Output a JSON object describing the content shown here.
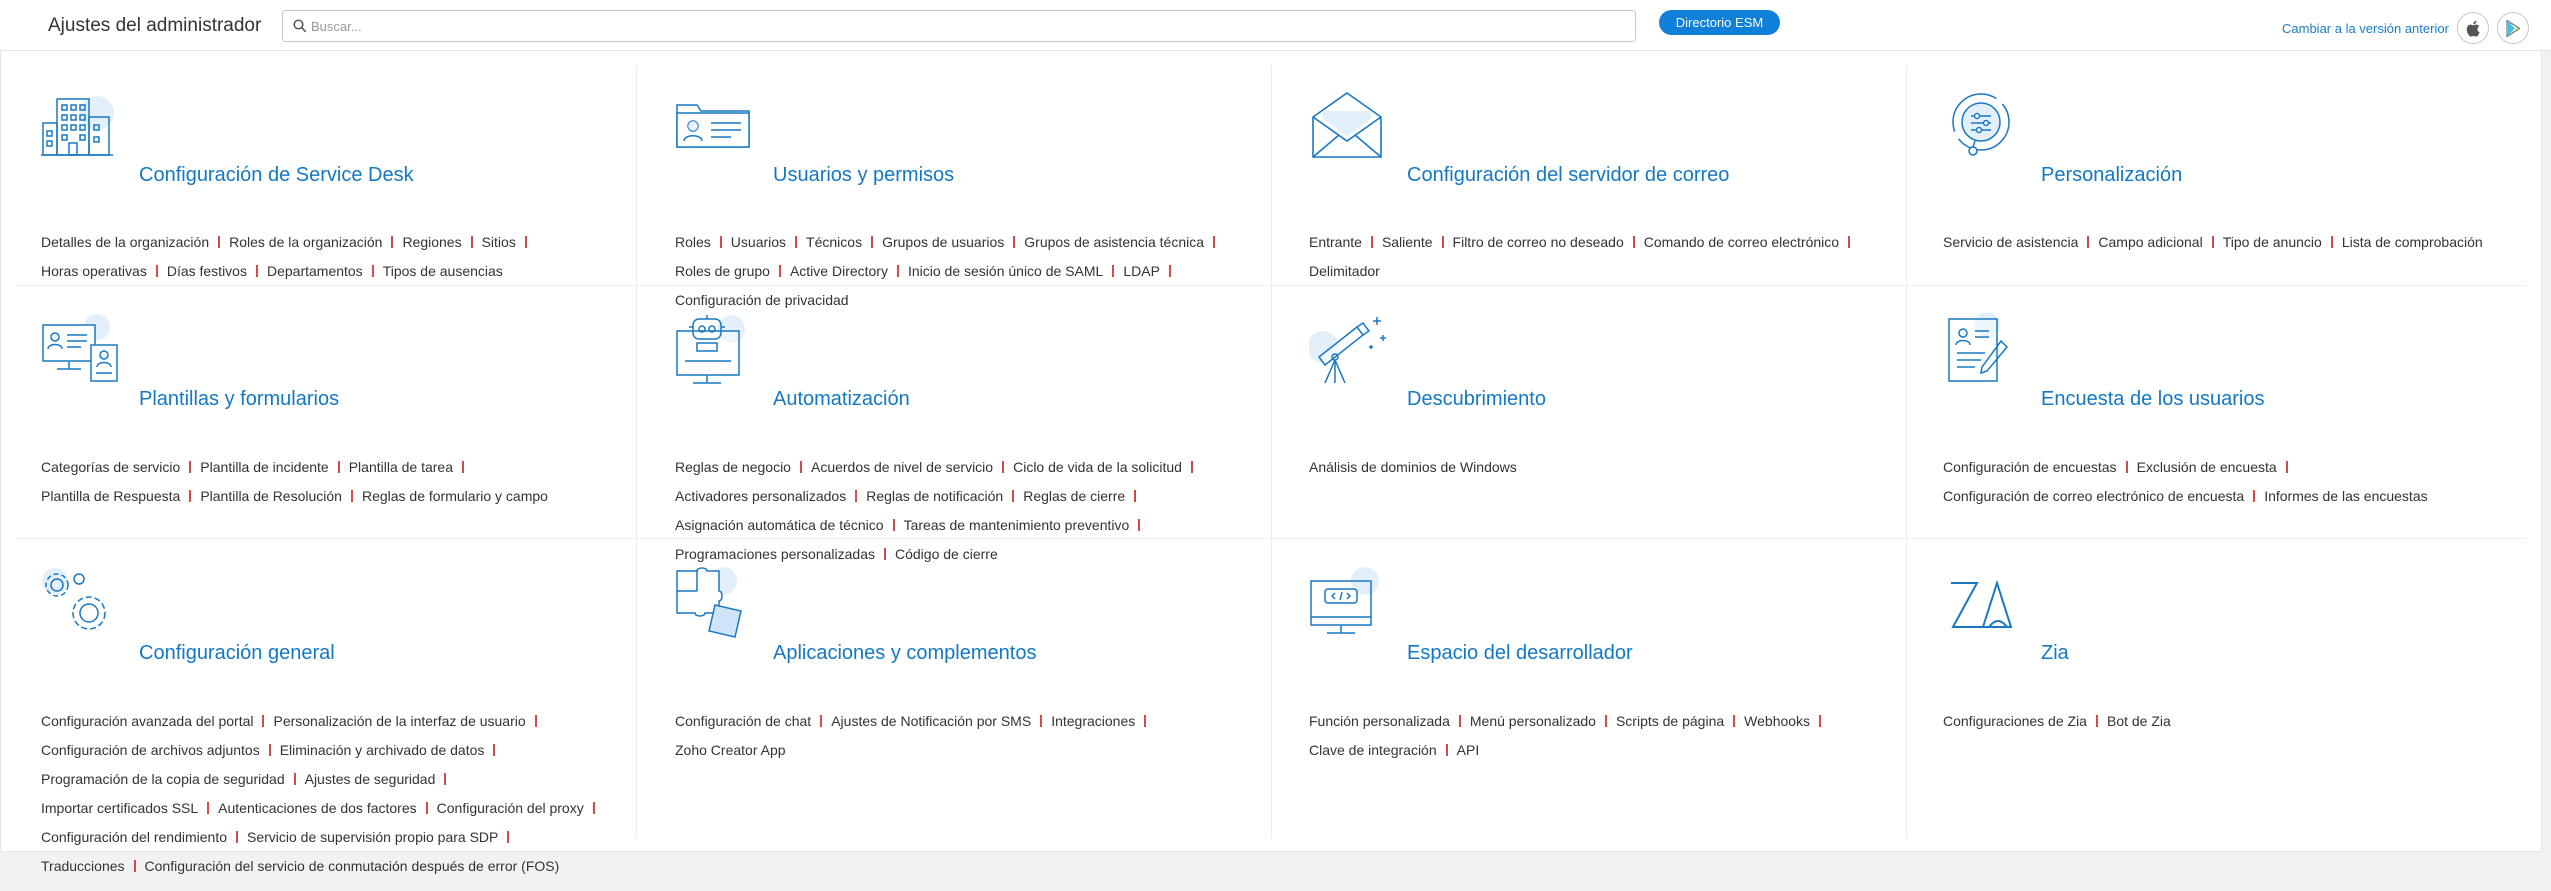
{
  "header": {
    "title": "Ajustes del administrador",
    "search_placeholder": "Buscar...",
    "esm_button": "Directorio ESM",
    "old_version_link": "Cambiar a la versión anterior"
  },
  "colors": {
    "accent": "#1478c2",
    "button": "#0f7fd8",
    "separator": "#d24b4b",
    "icon_bubble": "#e3f0fb"
  },
  "cards": [
    {
      "title": "Configuración de Service Desk",
      "icon": "building-icon",
      "lines": [
        [
          "Detalles de la organización",
          "Roles de la organización",
          "Regiones",
          "Sitios"
        ],
        [
          "Horas operativas",
          "Días festivos",
          "Departamentos",
          "Tipos de ausencias"
        ]
      ]
    },
    {
      "title": "Usuarios y permisos",
      "icon": "user-card-icon",
      "lines": [
        [
          "Roles",
          "Usuarios",
          "Técnicos",
          "Grupos de usuarios",
          "Grupos de asistencia técnica"
        ],
        [
          "Roles de grupo",
          "Active Directory",
          "Inicio de sesión único de SAML",
          "LDAP"
        ],
        [
          "Configuración de privacidad"
        ]
      ]
    },
    {
      "title": "Configuración del servidor de correo",
      "icon": "envelope-icon",
      "lines": [
        [
          "Entrante",
          "Saliente",
          "Filtro de correo no deseado",
          "Comando de correo electrónico"
        ],
        [
          "Delimitador"
        ]
      ]
    },
    {
      "title": "Personalización",
      "icon": "customization-icon",
      "lines": [
        [
          "Servicio de asistencia",
          "Campo adicional",
          "Tipo de anuncio",
          "Lista de comprobación"
        ]
      ]
    },
    {
      "title": "Plantillas y formularios",
      "icon": "templates-icon",
      "lines": [
        [
          "Categorías de servicio",
          "Plantilla de incidente",
          "Plantilla de tarea"
        ],
        [
          "Plantilla de Respuesta",
          "Plantilla de Resolución",
          "Reglas de formulario y campo"
        ]
      ]
    },
    {
      "title": "Automatización",
      "icon": "robot-icon",
      "lines": [
        [
          "Reglas de negocio",
          "Acuerdos de nivel de servicio",
          "Ciclo de vida de la solicitud"
        ],
        [
          "Activadores personalizados",
          "Reglas de notificación",
          "Reglas de cierre"
        ],
        [
          "Asignación automática de técnico",
          "Tareas de mantenimiento preventivo"
        ],
        [
          "Programaciones personalizadas",
          "Código de cierre"
        ]
      ]
    },
    {
      "title": "Descubrimiento",
      "icon": "telescope-icon",
      "lines": [
        [
          "Análisis de dominios de Windows"
        ]
      ]
    },
    {
      "title": "Encuesta de los usuarios",
      "icon": "survey-icon",
      "lines": [
        [
          "Configuración de encuestas",
          "Exclusión de encuesta"
        ],
        [
          "Configuración de correo electrónico de encuesta",
          "Informes de las encuestas"
        ]
      ]
    },
    {
      "title": "Configuración general",
      "icon": "gears-icon",
      "lines": [
        [
          "Configuración avanzada del portal",
          "Personalización de la interfaz de usuario"
        ],
        [
          "Configuración de archivos adjuntos",
          "Eliminación y archivado de datos"
        ],
        [
          "Programación de la copia de seguridad",
          "Ajustes de seguridad"
        ],
        [
          "Importar certificados SSL",
          "Autenticaciones de dos factores",
          "Configuración del proxy"
        ],
        [
          "Configuración del rendimiento",
          "Servicio de supervisión propio para SDP"
        ],
        [
          "Traducciones",
          "Configuración del servicio de conmutación después de error (FOS)"
        ]
      ]
    },
    {
      "title": "Aplicaciones y complementos",
      "icon": "puzzle-icon",
      "lines": [
        [
          "Configuración de chat",
          "Ajustes de Notificación por SMS",
          "Integraciones"
        ],
        [
          "Zoho Creator App"
        ]
      ]
    },
    {
      "title": "Espacio del desarrollador",
      "icon": "code-monitor-icon",
      "lines": [
        [
          "Función personalizada",
          "Menú personalizado",
          "Scripts de página",
          "Webhooks"
        ],
        [
          "Clave de integración",
          "API"
        ]
      ]
    },
    {
      "title": "Zia",
      "icon": "zia-icon",
      "lines": [
        [
          "Configuraciones de Zia",
          "Bot de Zia"
        ]
      ]
    }
  ]
}
